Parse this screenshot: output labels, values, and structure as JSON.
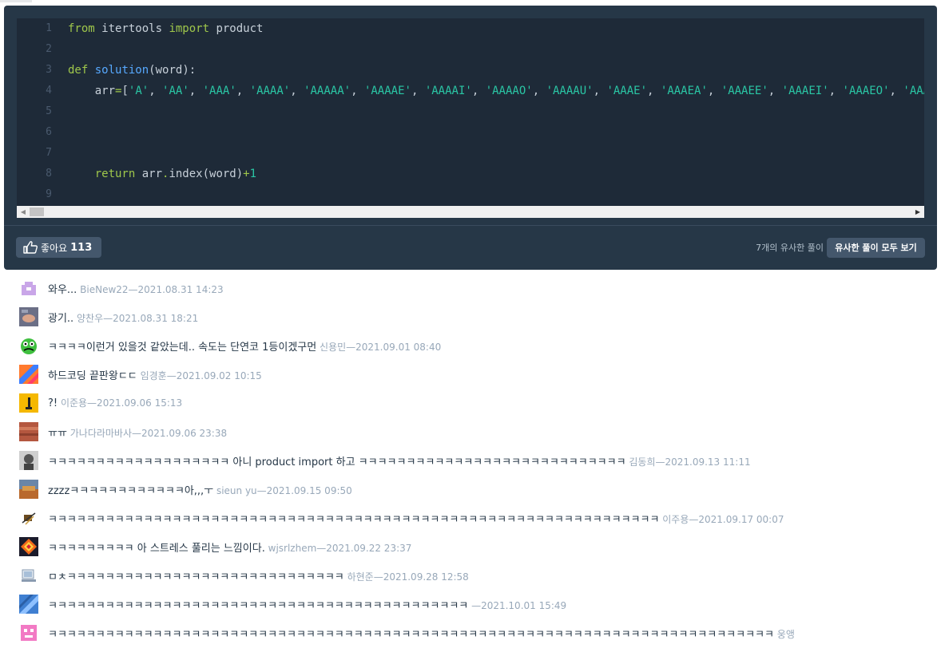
{
  "code": {
    "lines": [
      {
        "n": "1",
        "tokens": [
          {
            "t": "from",
            "c": "kw"
          },
          {
            "t": " itertools ",
            "c": ""
          },
          {
            "t": "import",
            "c": "kw"
          },
          {
            "t": " product",
            "c": ""
          }
        ]
      },
      {
        "n": "2",
        "tokens": []
      },
      {
        "n": "3",
        "tokens": [
          {
            "t": "def",
            "c": "kw"
          },
          {
            "t": " ",
            "c": ""
          },
          {
            "t": "solution",
            "c": "fn"
          },
          {
            "t": "(word):",
            "c": ""
          }
        ]
      },
      {
        "n": "4",
        "tokens": [
          {
            "t": "    arr",
            "c": ""
          },
          {
            "t": "=",
            "c": "op"
          },
          {
            "t": "[",
            "c": ""
          },
          {
            "t": "'A'",
            "c": "str"
          },
          {
            "t": ", ",
            "c": ""
          },
          {
            "t": "'AA'",
            "c": "str"
          },
          {
            "t": ", ",
            "c": ""
          },
          {
            "t": "'AAA'",
            "c": "str"
          },
          {
            "t": ", ",
            "c": ""
          },
          {
            "t": "'AAAA'",
            "c": "str"
          },
          {
            "t": ", ",
            "c": ""
          },
          {
            "t": "'AAAAA'",
            "c": "str"
          },
          {
            "t": ", ",
            "c": ""
          },
          {
            "t": "'AAAAE'",
            "c": "str"
          },
          {
            "t": ", ",
            "c": ""
          },
          {
            "t": "'AAAAI'",
            "c": "str"
          },
          {
            "t": ", ",
            "c": ""
          },
          {
            "t": "'AAAAO'",
            "c": "str"
          },
          {
            "t": ", ",
            "c": ""
          },
          {
            "t": "'AAAAU'",
            "c": "str"
          },
          {
            "t": ", ",
            "c": ""
          },
          {
            "t": "'AAAE'",
            "c": "str"
          },
          {
            "t": ", ",
            "c": ""
          },
          {
            "t": "'AAAEA'",
            "c": "str"
          },
          {
            "t": ", ",
            "c": ""
          },
          {
            "t": "'AAAEE'",
            "c": "str"
          },
          {
            "t": ", ",
            "c": ""
          },
          {
            "t": "'AAAEI'",
            "c": "str"
          },
          {
            "t": ", ",
            "c": ""
          },
          {
            "t": "'AAAEO'",
            "c": "str"
          },
          {
            "t": ", ",
            "c": ""
          },
          {
            "t": "'AAAEU'",
            "c": "str"
          }
        ]
      },
      {
        "n": "5",
        "tokens": []
      },
      {
        "n": "6",
        "tokens": []
      },
      {
        "n": "7",
        "tokens": []
      },
      {
        "n": "8",
        "tokens": [
          {
            "t": "    ",
            "c": ""
          },
          {
            "t": "return",
            "c": "kw"
          },
          {
            "t": " arr",
            "c": ""
          },
          {
            "t": ".",
            "c": "op"
          },
          {
            "t": "index(word)",
            "c": ""
          },
          {
            "t": "+",
            "c": "op"
          },
          {
            "t": "1",
            "c": "num"
          }
        ]
      },
      {
        "n": "9",
        "tokens": []
      }
    ]
  },
  "actions": {
    "like_label": "좋아요",
    "like_count": "113",
    "similar_text": "7개의 유사한 풀이",
    "similar_button": "유사한 풀이 모두 보기"
  },
  "comments": [
    {
      "text": "와우...",
      "author": "BieNew22",
      "date": "2021.08.31 14:23",
      "avatar": "avatar-1"
    },
    {
      "text": "광기..",
      "author": "양찬우",
      "date": "2021.08.31 18:21",
      "avatar": "avatar-2"
    },
    {
      "text": "ㅋㅋㅋㅋ이런거 있을것 같았는데.. 속도는 단연코 1등이겠구먼",
      "author": "신용민",
      "date": "2021.09.01 08:40",
      "avatar": "avatar-3"
    },
    {
      "text": "하드코딩 끝판왕ㄷㄷ",
      "author": "임경훈",
      "date": "2021.09.02 10:15",
      "avatar": "avatar-4"
    },
    {
      "text": "?!",
      "author": "이준용",
      "date": "2021.09.06 15:13",
      "avatar": "avatar-5"
    },
    {
      "text": "ㅠㅠ",
      "author": "가나다라마바사",
      "date": "2021.09.06 23:38",
      "avatar": "avatar-6"
    },
    {
      "text": "ㅋㅋㅋㅋㅋㅋㅋㅋㅋㅋㅋㅋㅋㅋㅋㅋㅋㅋㅋ 아니 product import 하고 ㅋㅋㅋㅋㅋㅋㅋㅋㅋㅋㅋㅋㅋㅋㅋㅋㅋㅋㅋㅋㅋㅋㅋㅋㅋㅋㅋㅋ",
      "author": "김동희",
      "date": "2021.09.13 11:11",
      "avatar": "avatar-7"
    },
    {
      "text": "zzzzㅋㅋㅋㅋㅋㅋㅋㅋㅋㅋㅋㅋ아,,,ㅜ",
      "author": "sieun yu",
      "date": "2021.09.15 09:50",
      "avatar": "avatar-8"
    },
    {
      "text": "ㅋㅋㅋㅋㅋㅋㅋㅋㅋㅋㅋㅋㅋㅋㅋㅋㅋㅋㅋㅋㅋㅋㅋㅋㅋㅋㅋㅋㅋㅋㅋㅋㅋㅋㅋㅋㅋㅋㅋㅋㅋㅋㅋㅋㅋㅋㅋㅋㅋㅋㅋㅋㅋㅋㅋㅋㅋㅋㅋㅋㅋㅋㅋㅋ",
      "author": "이주용",
      "date": "2021.09.17 00:07",
      "avatar": "avatar-9"
    },
    {
      "text": "ㅋㅋㅋㅋㅋㅋㅋㅋㅋ 아 스트레스 풀리는 느낌이다.",
      "author": "wjsrlzhem",
      "date": "2021.09.22 23:37",
      "avatar": "avatar-10"
    },
    {
      "text": "ㅁㅊㅋㅋㅋㅋㅋㅋㅋㅋㅋㅋㅋㅋㅋㅋㅋㅋㅋㅋㅋㅋㅋㅋㅋㅋㅋㅋㅋㅋㅋ",
      "author": "하현준",
      "date": "2021.09.28 12:58",
      "avatar": "avatar-11"
    },
    {
      "text": "ㅋㅋㅋㅋㅋㅋㅋㅋㅋㅋㅋㅋㅋㅋㅋㅋㅋㅋㅋㅋㅋㅋㅋㅋㅋㅋㅋㅋㅋㅋㅋㅋㅋㅋㅋㅋㅋㅋㅋㅋㅋㅋㅋㅋ",
      "author": "",
      "date": "2021.10.01 15:49",
      "avatar": "avatar-12"
    },
    {
      "text": "ㅋㅋㅋㅋㅋㅋㅋㅋㅋㅋㅋㅋㅋㅋㅋㅋㅋㅋㅋㅋㅋㅋㅋㅋㅋㅋㅋㅋㅋㅋㅋㅋㅋㅋㅋㅋㅋㅋㅋㅋㅋㅋㅋㅋㅋㅋㅋㅋㅋㅋㅋㅋㅋㅋㅋㅋㅋㅋㅋㅋㅋㅋㅋㅋㅋㅋㅋㅋㅋㅋㅋㅋㅋㅋㅋㅋ",
      "author": "웅앵",
      "date": "",
      "avatar": "avatar-13"
    }
  ]
}
